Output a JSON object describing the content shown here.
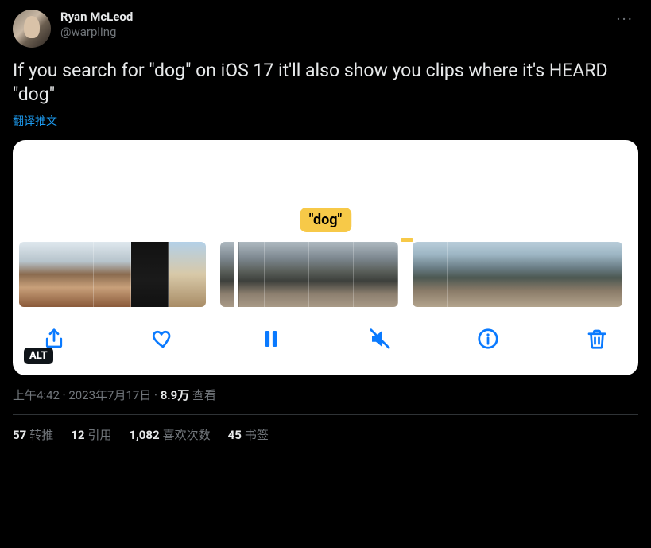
{
  "user": {
    "display_name": "Ryan McLeod",
    "handle": "@warpling"
  },
  "more_glyph": "···",
  "body_text": "If you search for \"dog\" on iOS 17 it'll also show you clips where it's HEARD \"dog\"",
  "translate_label": "翻译推文",
  "media": {
    "search_badge": "\"dog\"",
    "alt_badge": "ALT"
  },
  "meta": {
    "time": "上午4:42",
    "sep1": " · ",
    "date": "2023年7月17日",
    "sep2": " · ",
    "views_number": "8.9万",
    "views_label": " 查看"
  },
  "stats": {
    "retweets_num": "57",
    "retweets_label": "转推",
    "quotes_num": "12",
    "quotes_label": "引用",
    "likes_num": "1,082",
    "likes_label": "喜欢次数",
    "bookmarks_num": "45",
    "bookmarks_label": "书签"
  }
}
